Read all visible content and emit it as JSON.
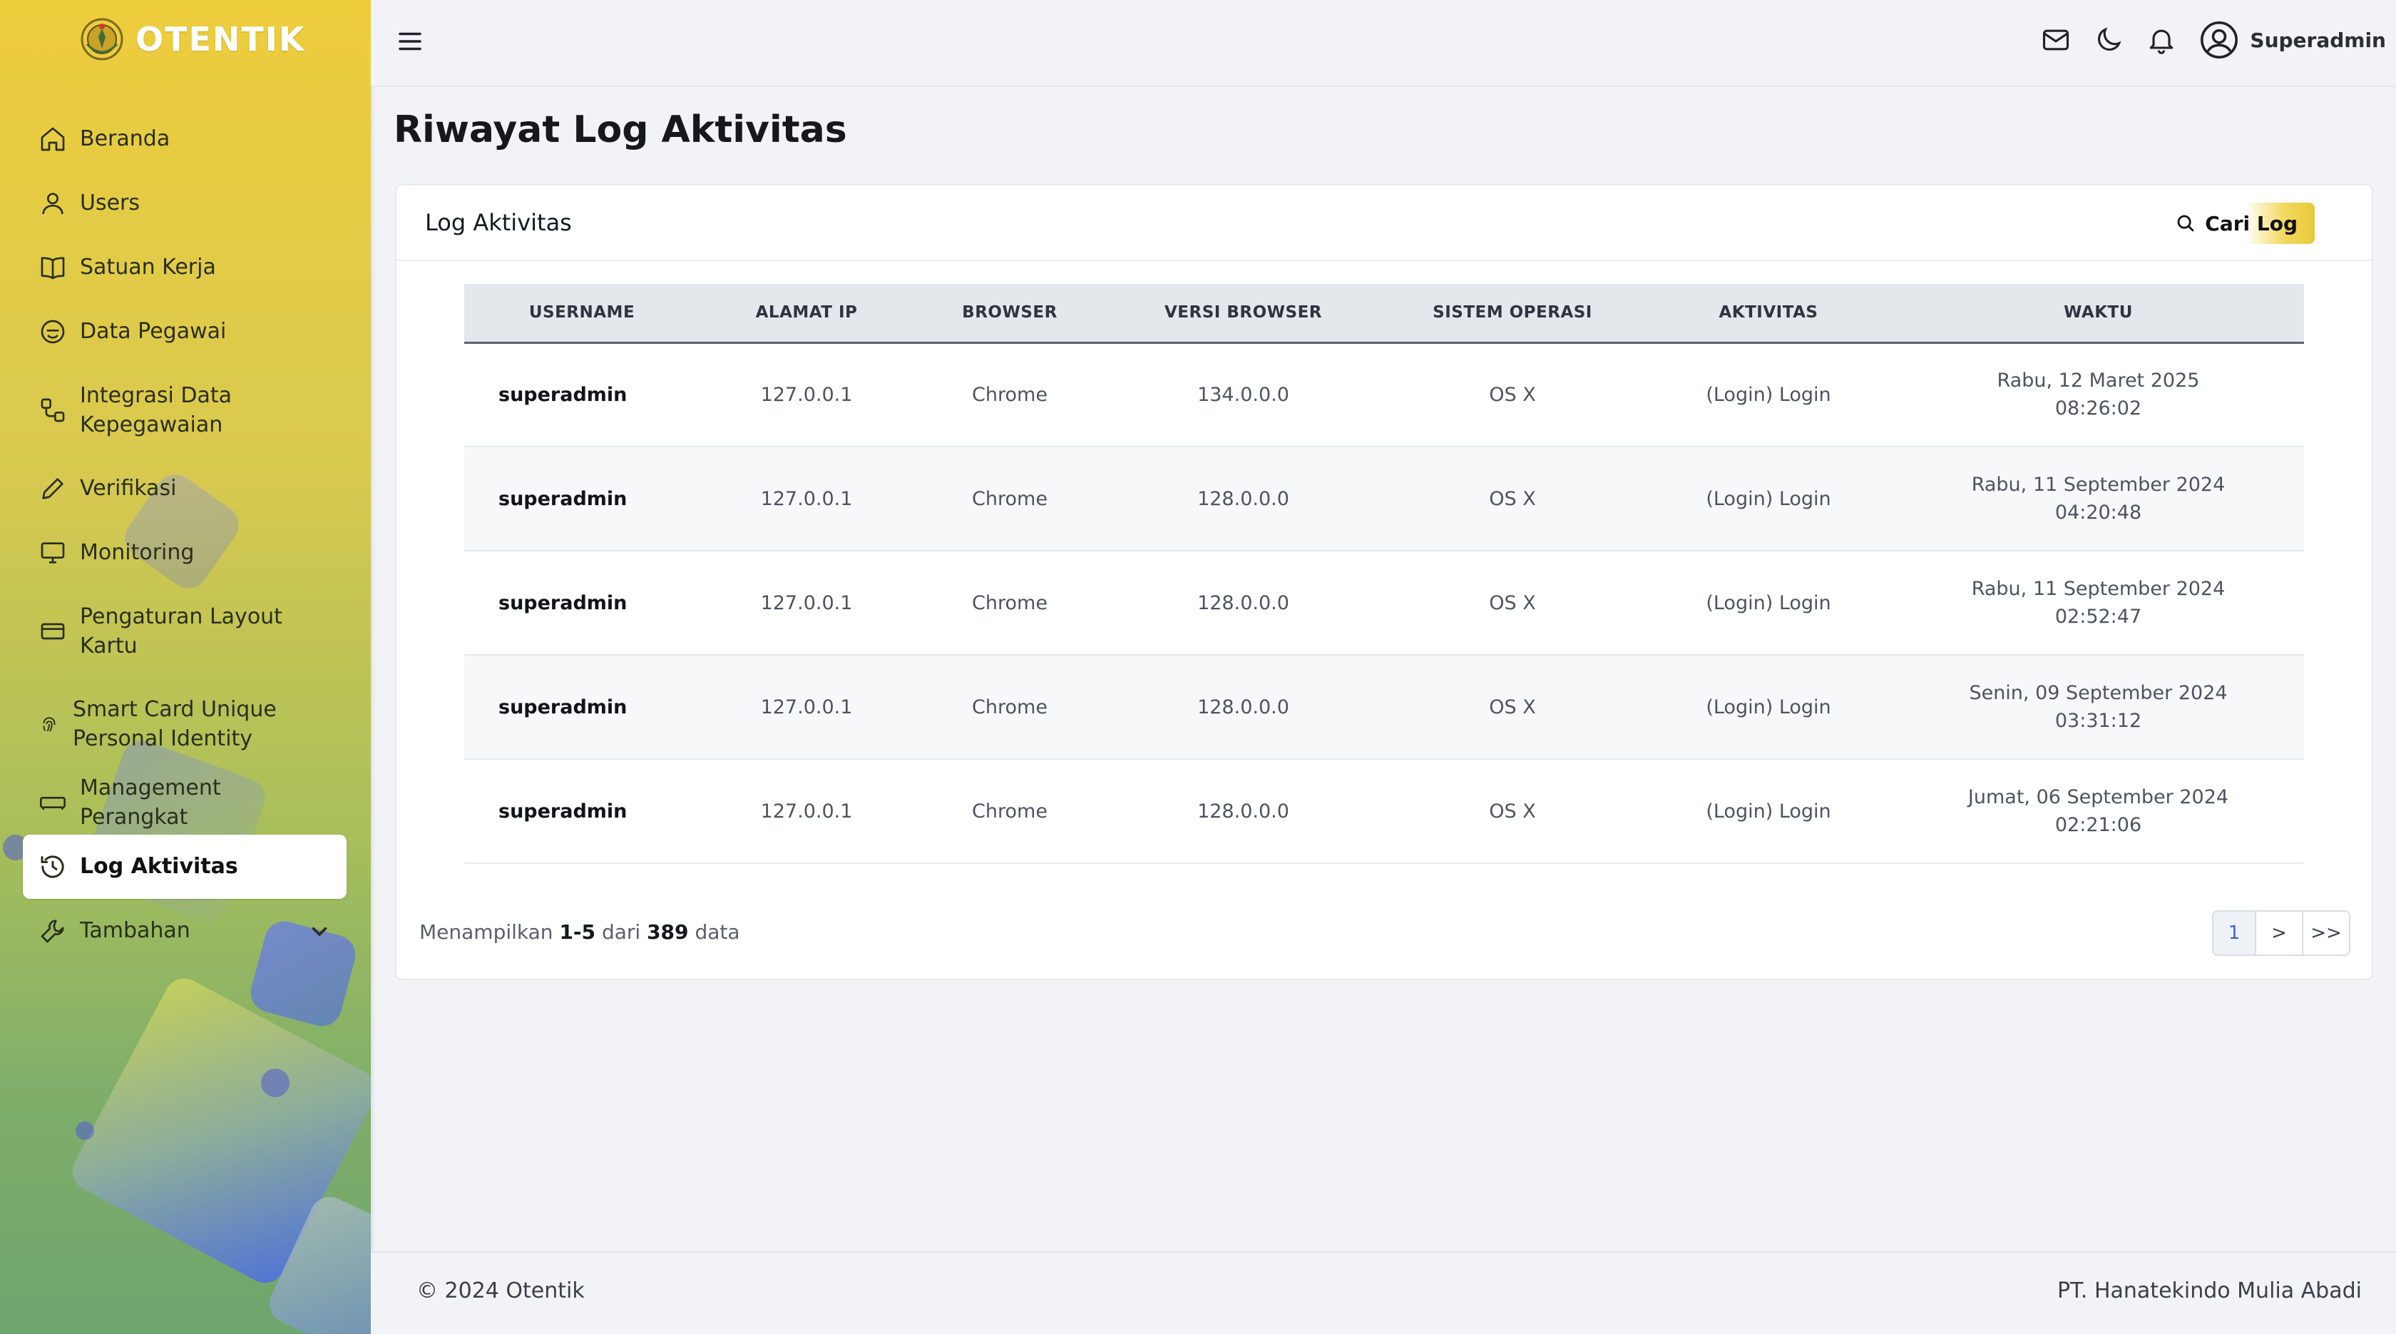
{
  "brand": {
    "name": "OTENTIK"
  },
  "sidebar": {
    "items": [
      {
        "label": "Beranda"
      },
      {
        "label": "Users"
      },
      {
        "label": "Satuan Kerja"
      },
      {
        "label": "Data Pegawai"
      },
      {
        "label": "Integrasi Data Kepegawaian"
      },
      {
        "label": "Verifikasi"
      },
      {
        "label": "Monitoring"
      },
      {
        "label": "Pengaturan Layout Kartu"
      },
      {
        "label": "Smart Card Unique Personal Identity"
      },
      {
        "label": "Management Perangkat"
      },
      {
        "label": "Log Aktivitas",
        "active": true
      },
      {
        "label": "Tambahan"
      }
    ]
  },
  "topbar": {
    "user_name": "Superadmin"
  },
  "page": {
    "title": "Riwayat Log Aktivitas"
  },
  "card": {
    "title": "Log Aktivitas",
    "search_label": "Cari Log"
  },
  "table": {
    "columns": [
      "USERNAME",
      "ALAMAT IP",
      "BROWSER",
      "VERSI BROWSER",
      "SISTEM OPERASI",
      "AKTIVITAS",
      "WAKTU"
    ],
    "rows": [
      {
        "username": "superadmin",
        "ip": "127.0.0.1",
        "browser": "Chrome",
        "version": "134.0.0.0",
        "os": "OS X",
        "activity": "(Login) Login",
        "date": "Rabu, 12 Maret 2025",
        "time": "08:26:02"
      },
      {
        "username": "superadmin",
        "ip": "127.0.0.1",
        "browser": "Chrome",
        "version": "128.0.0.0",
        "os": "OS X",
        "activity": "(Login) Login",
        "date": "Rabu, 11 September 2024",
        "time": "04:20:48"
      },
      {
        "username": "superadmin",
        "ip": "127.0.0.1",
        "browser": "Chrome",
        "version": "128.0.0.0",
        "os": "OS X",
        "activity": "(Login) Login",
        "date": "Rabu, 11 September 2024",
        "time": "02:52:47"
      },
      {
        "username": "superadmin",
        "ip": "127.0.0.1",
        "browser": "Chrome",
        "version": "128.0.0.0",
        "os": "OS X",
        "activity": "(Login) Login",
        "date": "Senin, 09 September 2024",
        "time": "03:31:12"
      },
      {
        "username": "superadmin",
        "ip": "127.0.0.1",
        "browser": "Chrome",
        "version": "128.0.0.0",
        "os": "OS X",
        "activity": "(Login) Login",
        "date": "Jumat, 06 September 2024",
        "time": "02:21:06"
      }
    ]
  },
  "pagination": {
    "prefix": "Menampilkan",
    "range": "1-5",
    "middle": "dari",
    "total": "389",
    "suffix": "data",
    "current_page": "1",
    "next_label": ">",
    "last_label": ">>"
  },
  "footer": {
    "copyright": "© 2024 Otentik",
    "company": "PT. Hanatekindo Mulia Abadi"
  }
}
